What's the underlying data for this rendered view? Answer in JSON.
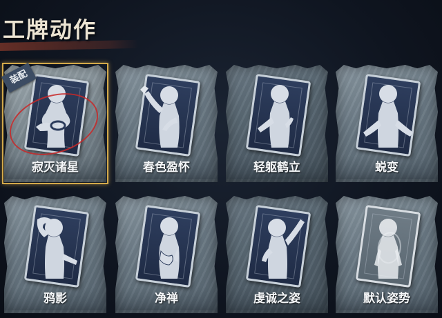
{
  "title": "工牌动作",
  "equip_badge": "装配",
  "cards": [
    {
      "label": "寂灭诸星",
      "figure": "figure-icon-pose-1",
      "selected": true
    },
    {
      "label": "春色盈怀",
      "figure": "figure-icon-pose-2"
    },
    {
      "label": "轻躯鹤立",
      "figure": "figure-icon-pose-3"
    },
    {
      "label": "蜕变",
      "figure": "figure-icon-pose-4"
    },
    {
      "label": "鸦影",
      "figure": "figure-icon-pose-5"
    },
    {
      "label": "净禅",
      "figure": "figure-icon-pose-6"
    },
    {
      "label": "虔诚之姿",
      "figure": "figure-icon-pose-7"
    },
    {
      "label": "默认姿势",
      "figure": "figure-icon-default"
    }
  ],
  "colors": {
    "accent_gold": "#d3a94a",
    "ribbon_red": "#783428",
    "mark_red": "#c82828"
  }
}
